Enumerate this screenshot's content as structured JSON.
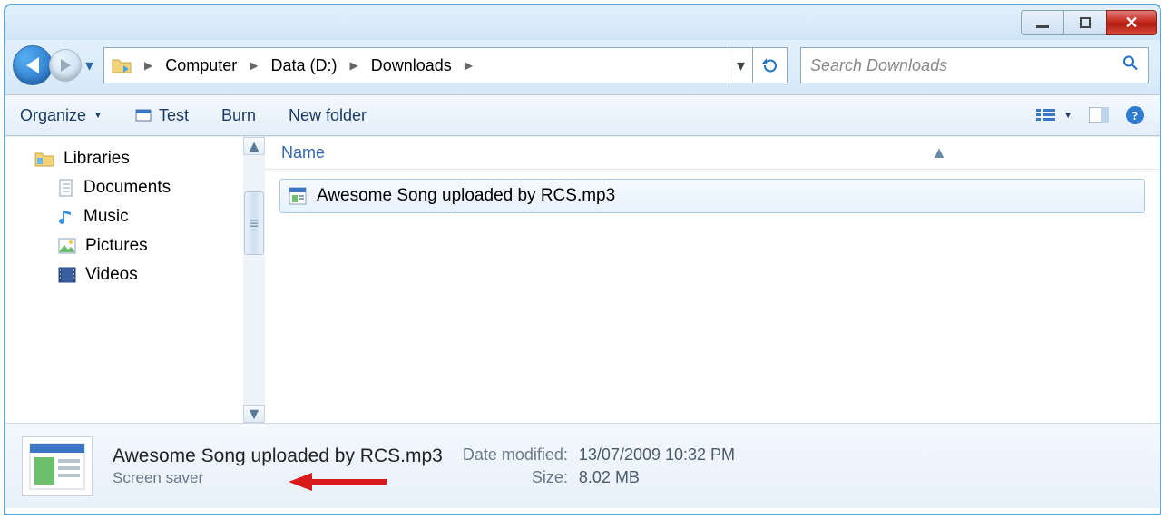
{
  "window_controls": {
    "min": "min",
    "max": "max",
    "close": "close"
  },
  "breadcrumb": {
    "items": [
      "Computer",
      "Data (D:)",
      "Downloads"
    ]
  },
  "search": {
    "placeholder": "Search Downloads"
  },
  "toolbar": {
    "organize": "Organize",
    "test": "Test",
    "burn": "Burn",
    "newfolder": "New folder"
  },
  "navpane": {
    "libraries": "Libraries",
    "documents": "Documents",
    "music": "Music",
    "pictures": "Pictures",
    "videos": "Videos"
  },
  "columns": {
    "name": "Name"
  },
  "files": [
    {
      "name": "Awesome Song uploaded by RCS.mp3"
    }
  ],
  "details": {
    "filename": "Awesome Song uploaded by RCS.mp3",
    "type": "Screen saver",
    "date_modified_label": "Date modified:",
    "date_modified_value": "13/07/2009 10:32 PM",
    "size_label": "Size:",
    "size_value": "8.02 MB"
  }
}
